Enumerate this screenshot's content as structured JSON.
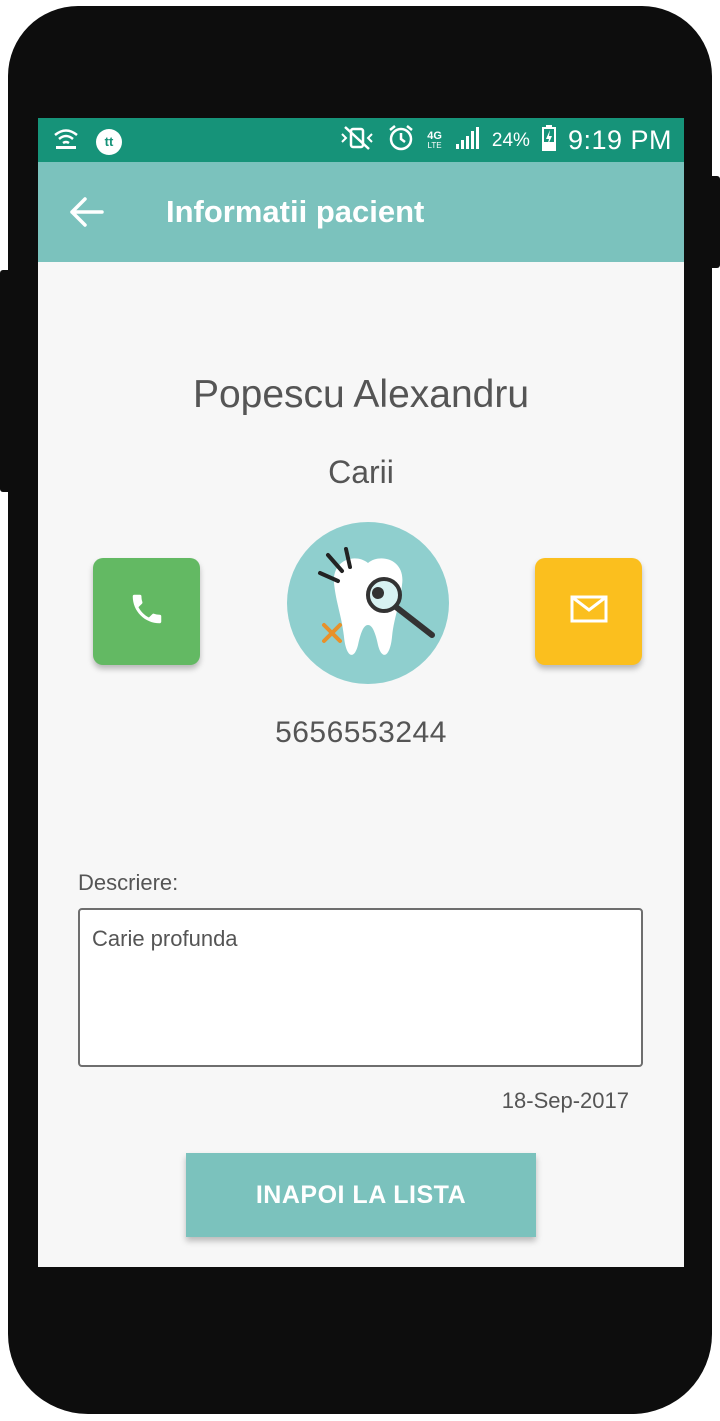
{
  "status_bar": {
    "time": "9:19 PM",
    "battery_percent": "24%",
    "network_type": "4G",
    "network_sub": "LTE",
    "app_badge": "tt",
    "icons": [
      "hotspot-icon",
      "app-badge-icon",
      "vibrate-icon",
      "alarm-icon",
      "signal-icon",
      "battery-charging-icon"
    ]
  },
  "app_bar": {
    "title": "Informatii pacient",
    "back_icon": "arrow-left-icon"
  },
  "patient": {
    "name": "Popescu Alexandru",
    "diagnosis": "Carii",
    "phone": "5656553244",
    "avatar_icon": "tooth-magnifier-icon"
  },
  "actions": {
    "call_icon": "phone-icon",
    "mail_icon": "mail-icon"
  },
  "description": {
    "label": "Descriere:",
    "value": "Carie profunda"
  },
  "date": "18-Sep-2017",
  "back_button_label": "INAPOI LA LISTA",
  "colors": {
    "status_bar": "#169379",
    "app_bar": "#7bc2bd",
    "call_button": "#63b963",
    "mail_button": "#fbbf1e",
    "primary_button": "#7bc2bd"
  }
}
